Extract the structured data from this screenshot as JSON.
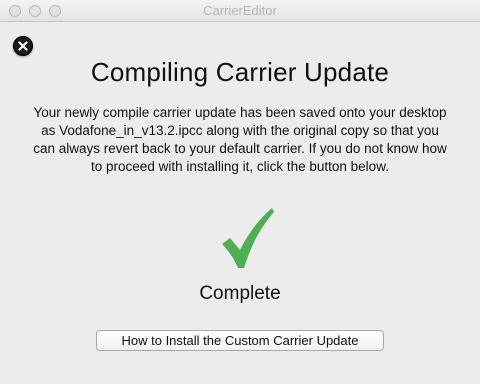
{
  "window": {
    "title": "CarrierEditor"
  },
  "dialog": {
    "heading": "Compiling Carrier Update",
    "message": "Your newly compile carrier update has been saved onto your desktop as Vodafone_in_v13.2.ipcc along with the original copy so that you can always revert back to your default carrier. If you do not know how to proceed with installing it, click the button below.",
    "status": "Complete",
    "install_button_label": "How to Install the Custom Carrier Update"
  },
  "icons": {
    "close": "close-x-icon",
    "status": "checkmark-icon"
  },
  "colors": {
    "checkmark": "#4caf50",
    "background": "#ececec"
  }
}
